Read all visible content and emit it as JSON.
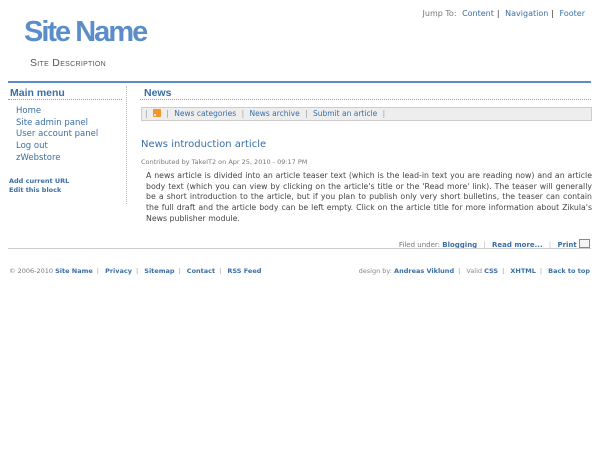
{
  "header": {
    "site_name": "Site Name",
    "site_description": "Site Description",
    "jump_to": {
      "label": "Jump To:",
      "links": [
        "Content",
        "Navigation",
        "Footer"
      ]
    }
  },
  "sidebar": {
    "title": "Main menu",
    "menu_items": [
      "Home",
      "Site admin panel",
      "User account panel",
      "Log out",
      "zWebstore"
    ],
    "block_links": [
      "Add current URL",
      "Edit this block"
    ]
  },
  "main": {
    "section_title": "News",
    "news_links": [
      "News categories",
      "News archive",
      "Submit an article"
    ],
    "article": {
      "title": "News introduction article",
      "byline": "Contributed by TakeIT2 on Apr 25, 2010 - 09:17 PM",
      "body": "A news article is divided into an article teaser text (which is the lead-in text you are reading now) and an article body text (which you can view by clicking on the article's title or the 'Read more' link). The teaser will generally be a short introduction to the article, but if you plan to publish only very short bulletins, the teaser can contain the full draft and the article body can be left empty. Click on the article title for more information about Zikula's News publisher module."
    },
    "filed_under_label": "Filed under:",
    "category": "Blogging",
    "read_more": "Read more...",
    "print": "Print"
  },
  "footer": {
    "copyright": "© 2006-2010",
    "links": [
      "Site Name",
      "Privacy",
      "Sitemap",
      "Contact",
      "RSS Feed"
    ],
    "design_by_label": "design by:",
    "designer": "Andreas Viklund",
    "valid_label": "Valid",
    "valid_links": [
      "CSS",
      "XHTML"
    ],
    "back_to_top": "Back to top"
  },
  "colors": {
    "accent": "#3a6ea5",
    "brand": "#5b8ec8",
    "rss": "#f39526"
  }
}
